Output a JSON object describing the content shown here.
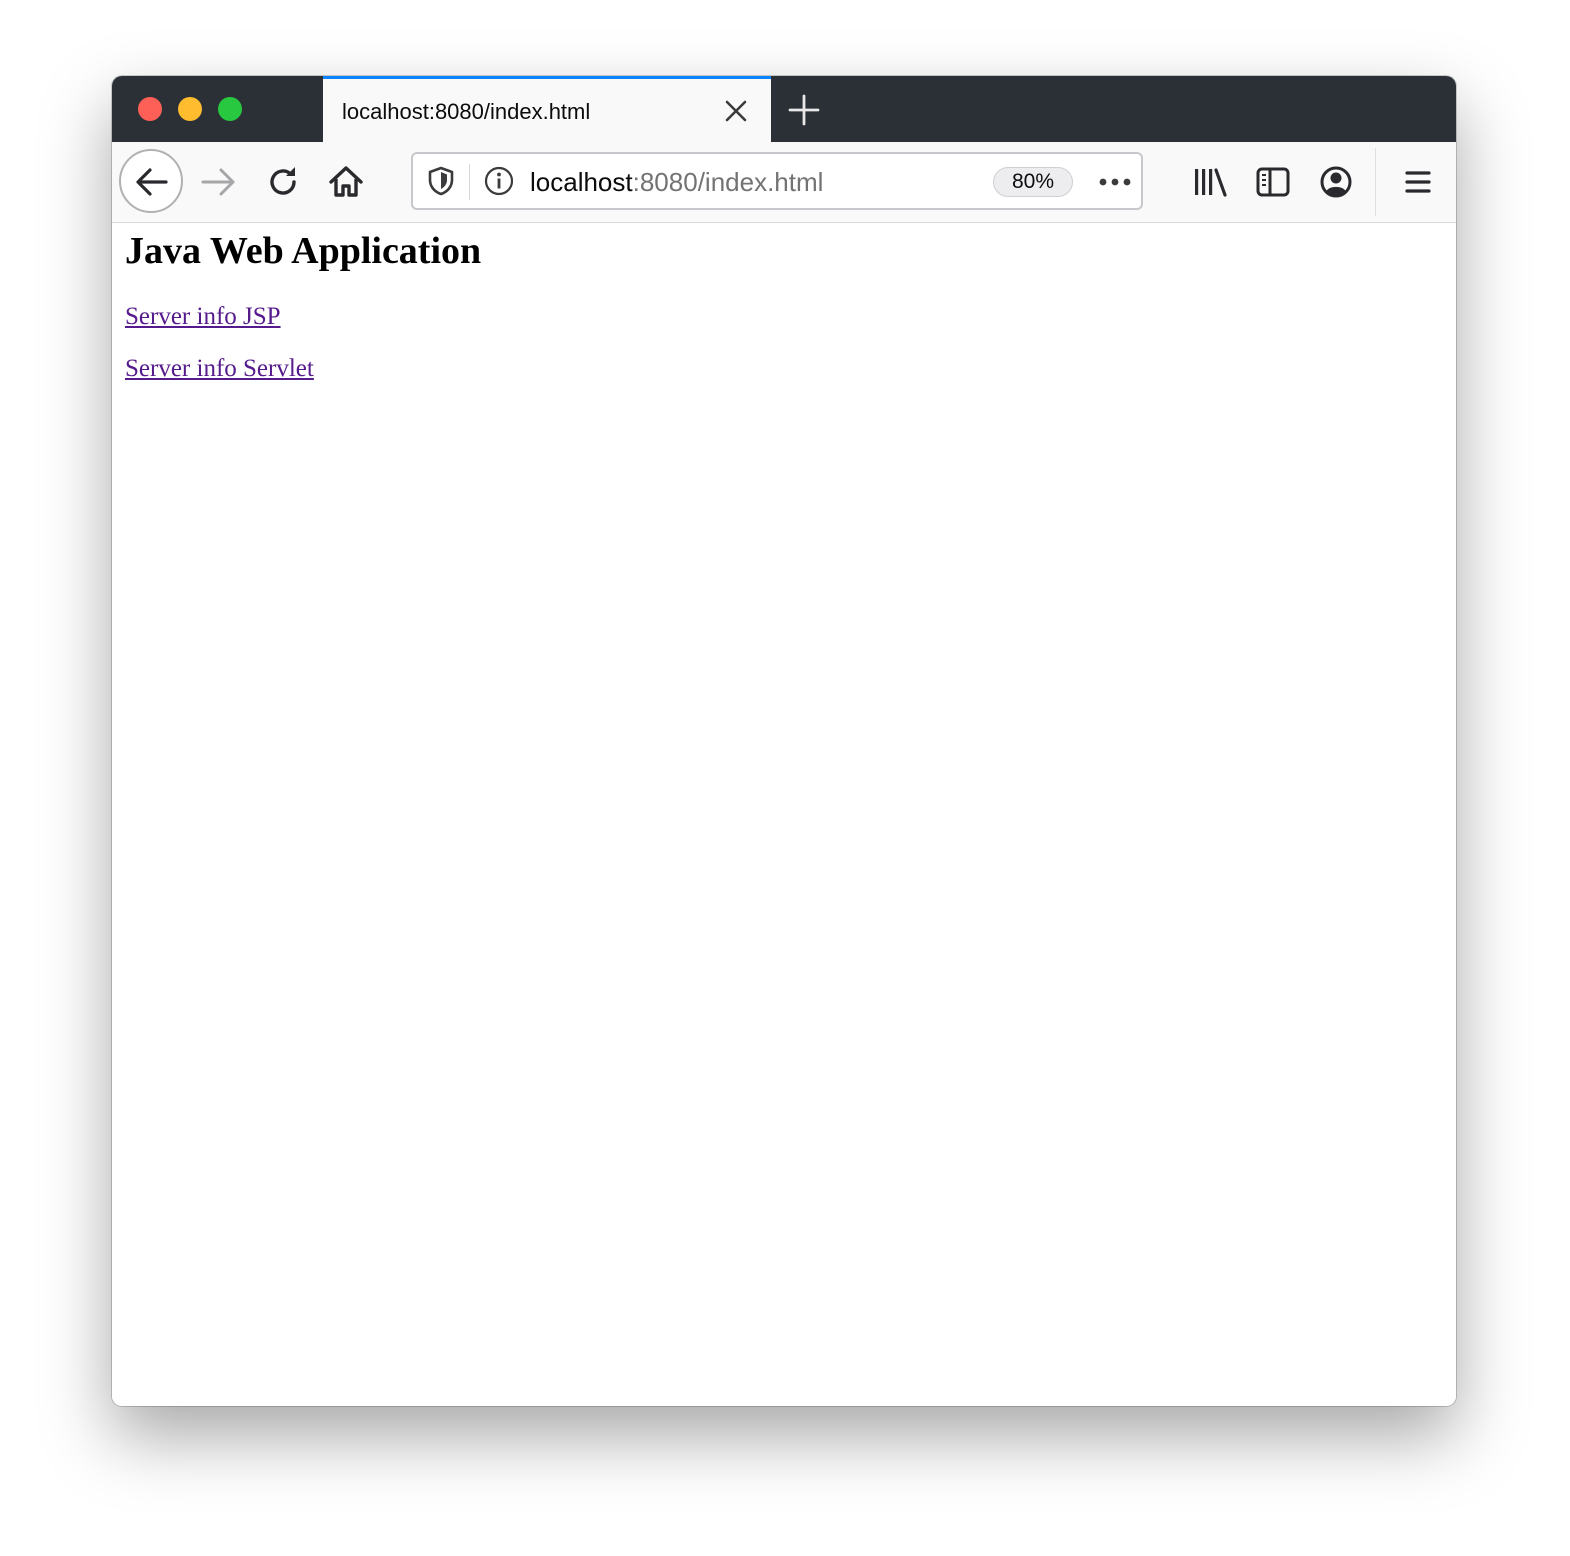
{
  "browser": {
    "tab": {
      "title": "localhost:8080/index.html"
    },
    "urlbar": {
      "host": "localhost",
      "rest": ":8080/index.html",
      "zoom": "80%"
    },
    "colors": {
      "tab_accent": "#0a84ff",
      "tabstrip_bg": "#2b3036",
      "link_visited": "#551a8b"
    },
    "icons": [
      "back-arrow-icon",
      "forward-arrow-icon",
      "reload-icon",
      "home-icon",
      "tracking-shield-icon",
      "site-info-icon",
      "page-actions-icon",
      "library-icon",
      "sidebar-icon",
      "account-icon",
      "hamburger-menu-icon",
      "close-icon",
      "plus-icon"
    ]
  },
  "page": {
    "heading": "Java Web Application",
    "links": [
      {
        "label": "Server info JSP"
      },
      {
        "label": "Server info Servlet"
      }
    ]
  }
}
